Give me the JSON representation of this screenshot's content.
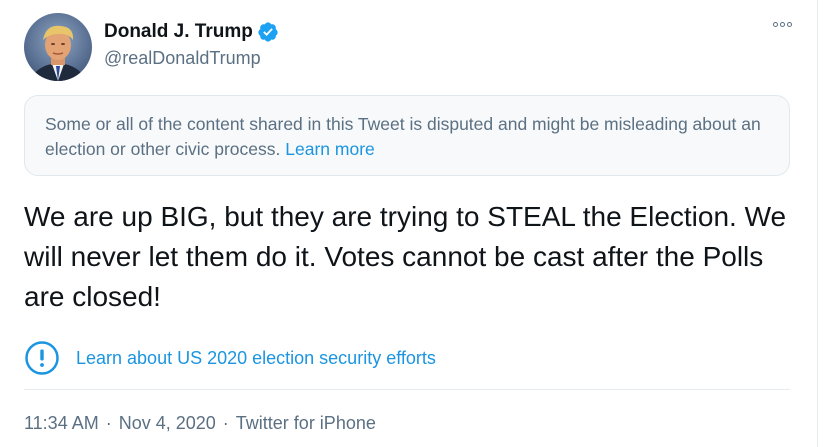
{
  "author": {
    "display_name": "Donald J. Trump",
    "handle": "@realDonaldTrump",
    "verified": true,
    "avatar_icon": "profile-photo"
  },
  "notice": {
    "text": "Some or all of the content shared in this Tweet is disputed and might be misleading about an election or other civic process.",
    "link_label": "Learn more"
  },
  "tweet": {
    "text": "We are up BIG, but they are trying to STEAL the Election. We will never let them do it. Votes cannot be cast after the Polls are closed!"
  },
  "election_link": {
    "icon": "exclamation-circle-icon",
    "label": "Learn about US 2020 election security efforts"
  },
  "meta": {
    "time": "11:34 AM",
    "separator": "·",
    "date": "Nov 4, 2020",
    "source": "Twitter for iPhone"
  },
  "colors": {
    "link": "#1b95e0",
    "secondary_text": "#5b7083",
    "verified": "#1da1f2"
  }
}
